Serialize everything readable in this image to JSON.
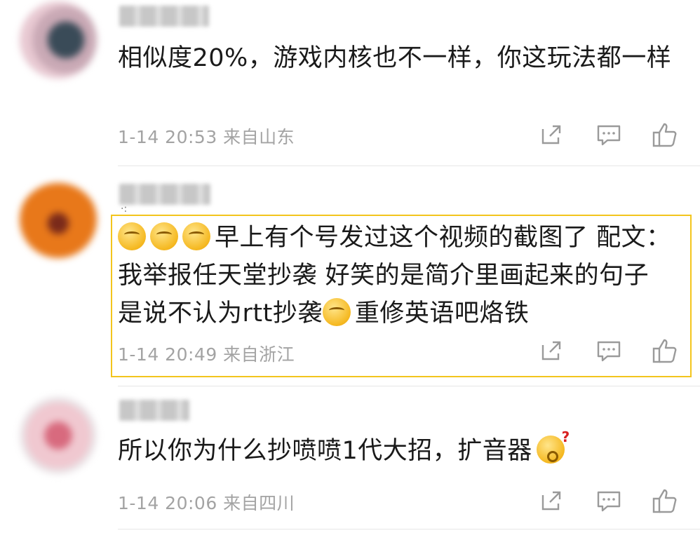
{
  "comments": [
    {
      "text": "相似度20%，游戏内核也不一样，你这玩法都一样",
      "meta": "1-14 20:53 来自山东"
    },
    {
      "text": "早上有个号发过这个视频的截图了 配文：我举报任天堂抄袭 好笑的是简介里画起来的句子是说不认为rtt抄袭",
      "text_after_emoji": "重修英语吧烙铁",
      "meta": "1-14 20:49 来自浙江"
    },
    {
      "text": "所以你为什么抄喷喷1代大招，扩音器",
      "meta": "1-14 20:06 来自四川"
    }
  ],
  "icons": {
    "share": "share-icon",
    "reply": "comment-icon",
    "like": "thumbs-up-icon",
    "emoji": "thinking-emoji-icon",
    "emoji_surprised": "surprised-emoji-icon"
  },
  "colors": {
    "highlight_border": "#f3c51d",
    "meta_text": "#a3a3a3",
    "body_text": "#1a1a1a"
  }
}
